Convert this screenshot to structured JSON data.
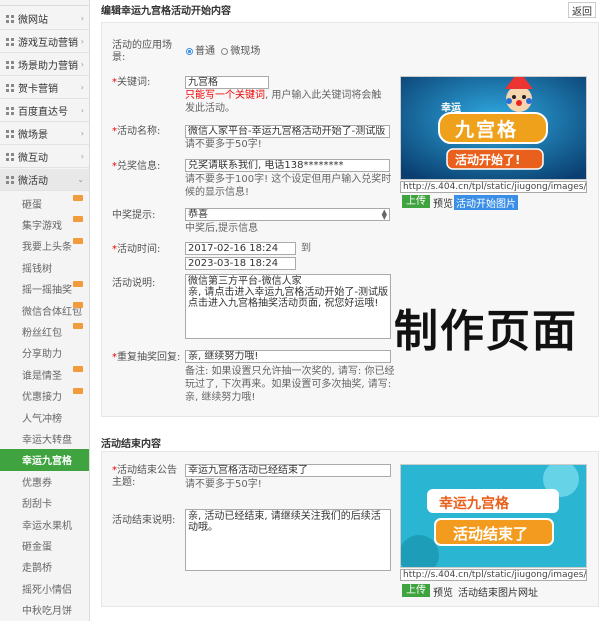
{
  "sidebar": {
    "menu": [
      {
        "label": "微网站",
        "icon": "grid-icon"
      },
      {
        "label": "游戏互动营销",
        "icon": "grid-icon"
      },
      {
        "label": "场景助力营销",
        "icon": "grid-icon"
      },
      {
        "label": "贺卡营销",
        "icon": "grid-icon"
      },
      {
        "label": "百度直达号",
        "icon": "grid-icon"
      },
      {
        "label": "微场景",
        "icon": "grid-icon"
      },
      {
        "label": "微互动",
        "icon": "grid-icon"
      },
      {
        "label": "微活动",
        "icon": "grid-icon"
      }
    ],
    "sub_items": [
      "砸蛋",
      "集字游戏",
      "我要上头条",
      "摇钱树",
      "摇一摇抽奖",
      "微信合体红包",
      "粉丝红包",
      "分享助力",
      "谁是情圣",
      "优惠接力",
      "人气冲榜",
      "幸运大转盘",
      "幸运九宫格",
      "优惠券",
      "刮刮卡",
      "幸运水果机",
      "砸金蛋",
      "走鹊桥",
      "摇死小情侣",
      "中秋吃月饼"
    ],
    "active_sub": "幸运九宫格"
  },
  "header": {
    "title": "编辑幸运九宫格活动开始内容",
    "back_label": "返回"
  },
  "start_form": {
    "scene_label": "活动的应用场景:",
    "scene_options": [
      "普通",
      "微现场"
    ],
    "keyword_label": "关键词:",
    "keyword_value": "九宫格",
    "keyword_hint_red": "只能写一个关键词",
    "keyword_hint": ", 用户输入此关键词将会触发此活动。",
    "name_label": "活动名称:",
    "name_value": "微信人家平台-幸运九宫格活动开始了-测试版",
    "name_hint": "请不要多于50字!",
    "redeem_label": "兑奖信息:",
    "redeem_value": "兑奖请联系我们, 电话138********",
    "redeem_hint": "请不要多于100字! 这个设定但用户输入兑奖时候的显示信息!",
    "prize_label": "中奖提示:",
    "prize_value": "恭喜",
    "prize_hint": "中奖后,提示信息",
    "time_label": "活动时间:",
    "time_start": "2017-02-16 18:24",
    "time_to": "到",
    "time_end": "2023-03-18 18:24",
    "desc_label": "活动说明:",
    "desc_value": "微信第三方平台-微信人家\n亲, 请点击进入幸运九宫格活动开始了-测试版点击进入九宫格抽奖活动页面, 祝您好运哦!",
    "repeat_label": "重复抽奖回复:",
    "repeat_value": "亲, 继续努力哦!",
    "repeat_hint": "备注: 如果设置只允许抽一次奖的, 请写: 你已经玩过了, 下次再来。如果设置可多次抽奖, 请写: 亲, 继续努力哦!",
    "image_url": "http://s.404.cn/tpl/static/jiugong/images/",
    "upload_label": "上传",
    "preview_label": "预览",
    "image_caption": "活动开始图片",
    "banner_line1": "幸运",
    "banner_line2": "九宫格",
    "banner_line3": "活动开始了!"
  },
  "watermark": "制作页面",
  "end_section": {
    "title": "活动结束内容",
    "announce_label": "活动结束公告主题:",
    "announce_value": "幸运九宫格活动已经结束了",
    "announce_hint": "请不要多于50字!",
    "desc_label": "活动结束说明:",
    "desc_value": "亲, 活动已经结束, 请继续关注我们的后续活动哦。",
    "image_url": "http://s.404.cn/tpl/static/jiugong/images/",
    "upload_label": "上传",
    "preview_label": "预览",
    "image_caption": "活动结束图片网址",
    "banner_line1": "幸运九宫格",
    "banner_line2": "活动结束了"
  },
  "colors": {
    "accent_green": "#3fa33f",
    "accent_blue": "#3a8ee6",
    "required_red": "#e00000"
  }
}
